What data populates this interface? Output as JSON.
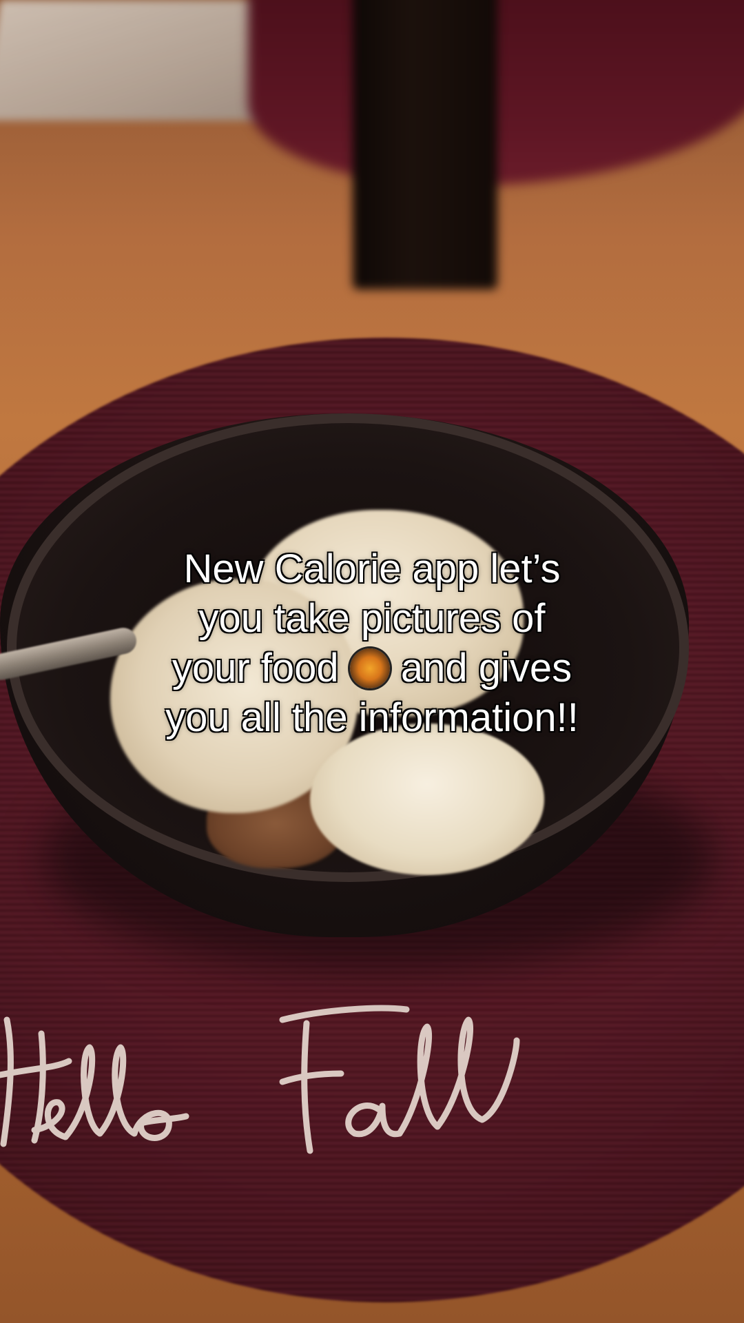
{
  "caption": {
    "line1": "New Calorie app let’s",
    "line2": "you take pictures of",
    "line3_before": "your food",
    "line3_after": "and gives",
    "line4": "you all the information!!",
    "emoji_icon": "cooking-pan-icon"
  },
  "placemat": {
    "script_text": "Hello Fall"
  },
  "colors": {
    "tablecloth": "#b36d3f",
    "placemat": "#521420",
    "bowl": "#1a1211",
    "ice_cream": "#efe3cc",
    "caption_text": "#ffffff"
  }
}
